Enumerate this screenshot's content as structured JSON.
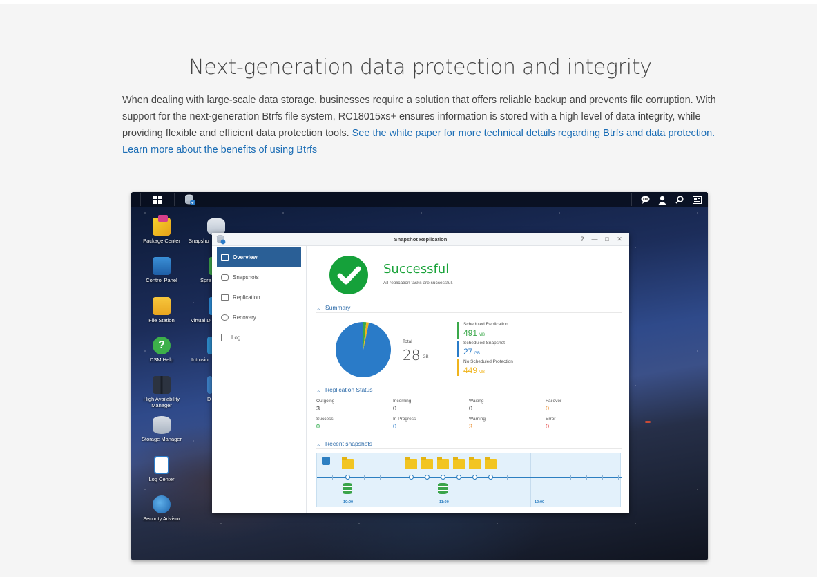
{
  "page": {
    "headline": "Next-generation data protection and integrity",
    "intro_text": "When dealing with large-scale data storage, businesses require a solution that offers reliable backup and prevents file corruption. With support for the next-generation Btrfs file system, RC18015xs+ ensures information is stored with a high level of data integrity, while providing flexible and efficient data protection tools.",
    "link_whitepaper": "See the white paper for more technical details regarding Btrfs and data protection.",
    "link_benefits": "Learn more about the benefits of using Btrfs",
    "link_color": "#1b6db5"
  },
  "desktop": {
    "icons": [
      {
        "label": "Package Center",
        "icon": "package-center-icon"
      },
      {
        "label": "Control Panel",
        "icon": "control-panel-icon"
      },
      {
        "label": "File Station",
        "icon": "file-station-icon"
      },
      {
        "label": "DSM Help",
        "icon": "help-icon"
      },
      {
        "label": "High Availability Manager",
        "icon": "high-availability-icon"
      },
      {
        "label": "Storage Manager",
        "icon": "storage-manager-icon"
      },
      {
        "label": "Log Center",
        "icon": "log-center-icon"
      },
      {
        "label": "Security Advisor",
        "icon": "security-advisor-icon"
      }
    ],
    "icons_col2": [
      {
        "label": "Snapsho",
        "icon": "snapshot-icon"
      },
      {
        "label": "Spre",
        "icon": "spreadsheet-icon"
      },
      {
        "label": "Virtual D",
        "icon": "virtual-drive-icon"
      },
      {
        "label": "Intrusio",
        "icon": "intrusion-icon"
      },
      {
        "label": "D",
        "icon": "app-icon"
      }
    ]
  },
  "window": {
    "title": "Snapshot Replication",
    "controls": {
      "help": "?",
      "minimize": "—",
      "maximize": "□",
      "close": "✕"
    },
    "nav": [
      {
        "label": "Overview",
        "icon": "overview-icon",
        "active": true
      },
      {
        "label": "Snapshots",
        "icon": "camera-icon",
        "active": false
      },
      {
        "label": "Replication",
        "icon": "replication-icon",
        "active": false
      },
      {
        "label": "Recovery",
        "icon": "recovery-icon",
        "active": false
      },
      {
        "label": "Log",
        "icon": "log-icon",
        "active": false
      }
    ],
    "status": {
      "title": "Successful",
      "subtitle": "All replication tasks are successful."
    },
    "summary": {
      "heading": "Summary",
      "total_label": "Total",
      "total_value": "28",
      "total_unit": "GB",
      "items": [
        {
          "label": "Scheduled Replication",
          "value": "491",
          "unit": "MB",
          "color": "#3aa84a",
          "mb": 491
        },
        {
          "label": "Scheduled Snapshot",
          "value": "27",
          "unit": "GB",
          "color": "#2a7bc8",
          "mb": 27648
        },
        {
          "label": "No Scheduled Protection",
          "value": "449",
          "unit": "MB",
          "color": "#f0b41c",
          "mb": 449
        }
      ]
    },
    "replication_status": {
      "heading": "Replication Status",
      "cells": [
        {
          "label": "Outgoing",
          "value": "3",
          "color": "#333"
        },
        {
          "label": "Incoming",
          "value": "0",
          "color": "#333"
        },
        {
          "label": "Waiting",
          "value": "0",
          "color": "#333"
        },
        {
          "label": "Failover",
          "value": "0",
          "color": "#e8831c"
        },
        {
          "label": "Success",
          "value": "0",
          "color": "#1aa33a"
        },
        {
          "label": "In Progress",
          "value": "0",
          "color": "#2a7bc8"
        },
        {
          "label": "Warning",
          "value": "3",
          "color": "#e8831c"
        },
        {
          "label": "Error",
          "value": "0",
          "color": "#e03030"
        }
      ]
    },
    "recent_snapshots": {
      "heading": "Recent snapshots",
      "times": [
        "10:00",
        "11:00",
        "12:00"
      ]
    }
  }
}
